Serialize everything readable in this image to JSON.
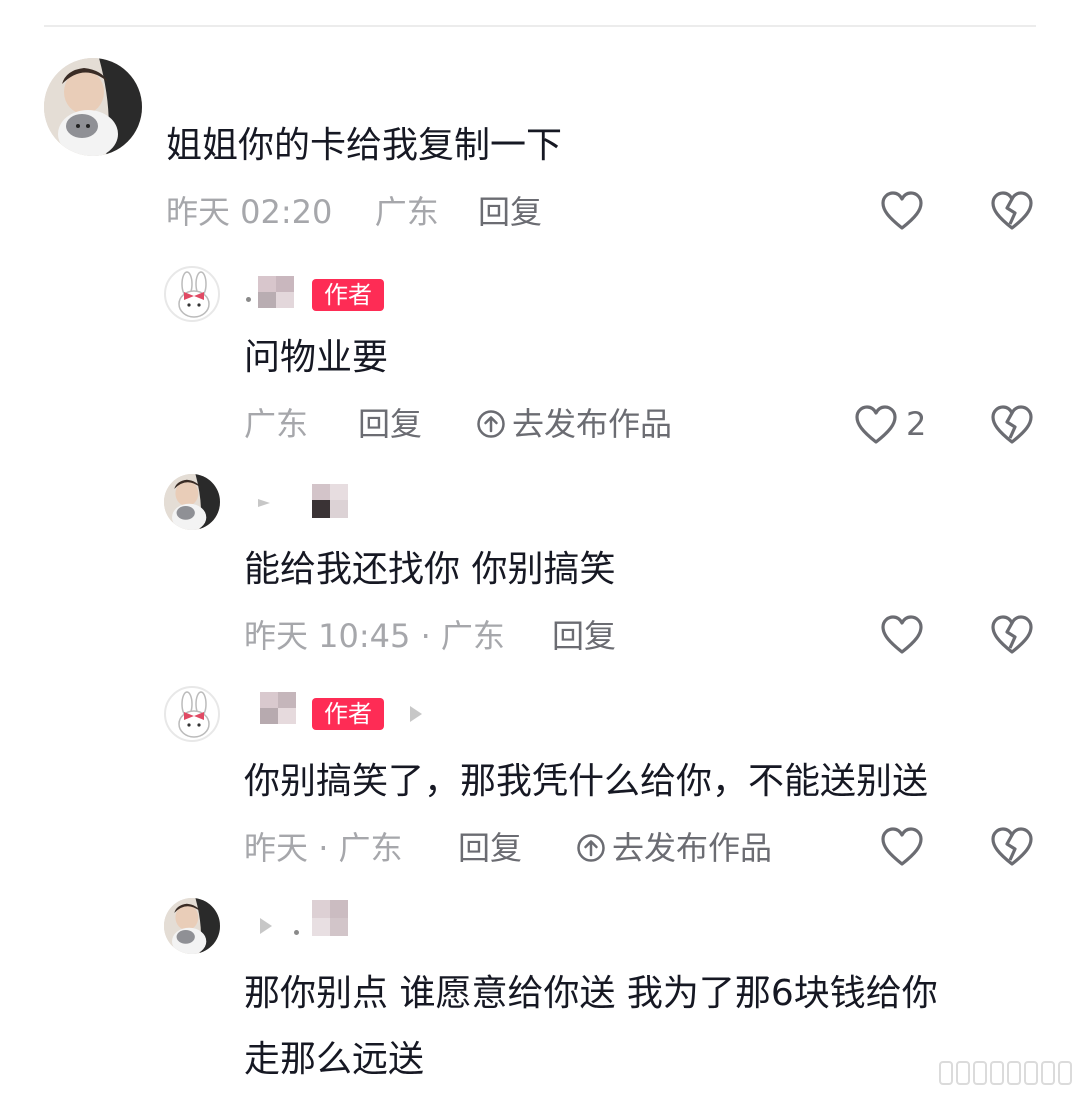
{
  "comment": {
    "text": "姐姐你的卡给我复制一下",
    "time": "昨天 02:20",
    "location": "广东",
    "reply_label": "回复"
  },
  "replies": [
    {
      "author_badge": "作者",
      "text": "问物业要",
      "location": "广东",
      "reply_label": "回复",
      "publish_label": "去发布作品",
      "like_count": "2"
    },
    {
      "text": "能给我还找你 你别搞笑",
      "time": "昨天 10:45",
      "location": "广东",
      "reply_label": "回复"
    },
    {
      "author_badge": "作者",
      "text": "你别搞笑了，那我凭什么给你，不能送别送",
      "time": "昨天",
      "location": "广东",
      "reply_label": "回复",
      "publish_label": "去发布作品"
    },
    {
      "text_line1": "那你别点 谁愿意给你送 我为了那6块钱给你",
      "text_line2": "走那么远送"
    }
  ],
  "icons": {
    "like": "heart-outline-icon",
    "dislike": "broken-heart-icon",
    "publish": "up-arrow-circle-icon"
  },
  "colors": {
    "badge": "#fe2c55",
    "meta": "#a6a7ab",
    "text": "#161823"
  }
}
